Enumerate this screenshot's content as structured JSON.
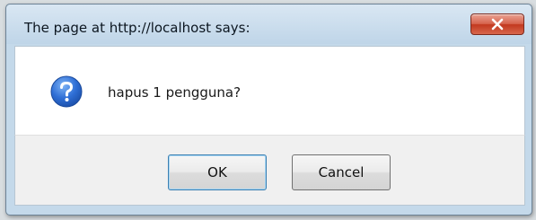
{
  "dialog": {
    "title": "The page at http://localhost says:",
    "close_label": "X",
    "message": "hapus 1 pengguna?",
    "icon": "question-icon",
    "buttons": {
      "ok_label": "OK",
      "cancel_label": "Cancel"
    }
  },
  "colors": {
    "close_button": "#c94a35",
    "icon_blue": "#2f6fd6",
    "ok_focus_border": "#3c7fb1"
  }
}
